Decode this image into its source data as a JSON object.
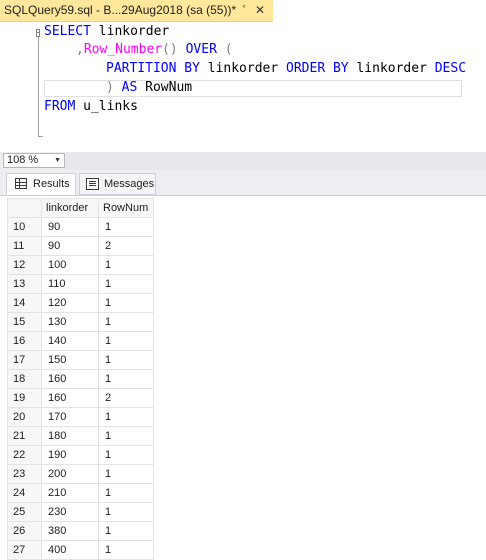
{
  "tab": {
    "title": "SQLQuery59.sql - B...29Aug2018 (sa (55))*",
    "pin_icon": "pin-icon",
    "close_icon": "close-icon"
  },
  "editor": {
    "lines": [
      {
        "kw1": "SELECT",
        "rest1": " linkorder"
      },
      {
        "punct": ",",
        "fn": "Row_Number",
        "paren": "()",
        "kw": " OVER",
        "paren2": " ("
      },
      {
        "kw1": "PARTITION BY",
        "mid": " linkorder ",
        "kw2": "ORDER BY",
        "rest": " linkorder ",
        "kw3": "DESC"
      },
      {
        "paren": ")",
        "kw": " AS",
        "rest": " RowNum"
      },
      {
        "kw1": "FROM",
        "rest1": " u_links"
      }
    ]
  },
  "zoom": {
    "value": "108 %"
  },
  "results_tabs": {
    "results": "Results",
    "messages": "Messages"
  },
  "grid": {
    "columns": [
      "",
      "linkorder",
      "RowNum"
    ],
    "rows": [
      [
        "10",
        "90",
        "1"
      ],
      [
        "11",
        "90",
        "2"
      ],
      [
        "12",
        "100",
        "1"
      ],
      [
        "13",
        "110",
        "1"
      ],
      [
        "14",
        "120",
        "1"
      ],
      [
        "15",
        "130",
        "1"
      ],
      [
        "16",
        "140",
        "1"
      ],
      [
        "17",
        "150",
        "1"
      ],
      [
        "18",
        "160",
        "1"
      ],
      [
        "19",
        "160",
        "2"
      ],
      [
        "20",
        "170",
        "1"
      ],
      [
        "21",
        "180",
        "1"
      ],
      [
        "22",
        "190",
        "1"
      ],
      [
        "23",
        "200",
        "1"
      ],
      [
        "24",
        "210",
        "1"
      ],
      [
        "25",
        "230",
        "1"
      ],
      [
        "26",
        "380",
        "1"
      ],
      [
        "27",
        "400",
        "1"
      ]
    ]
  }
}
